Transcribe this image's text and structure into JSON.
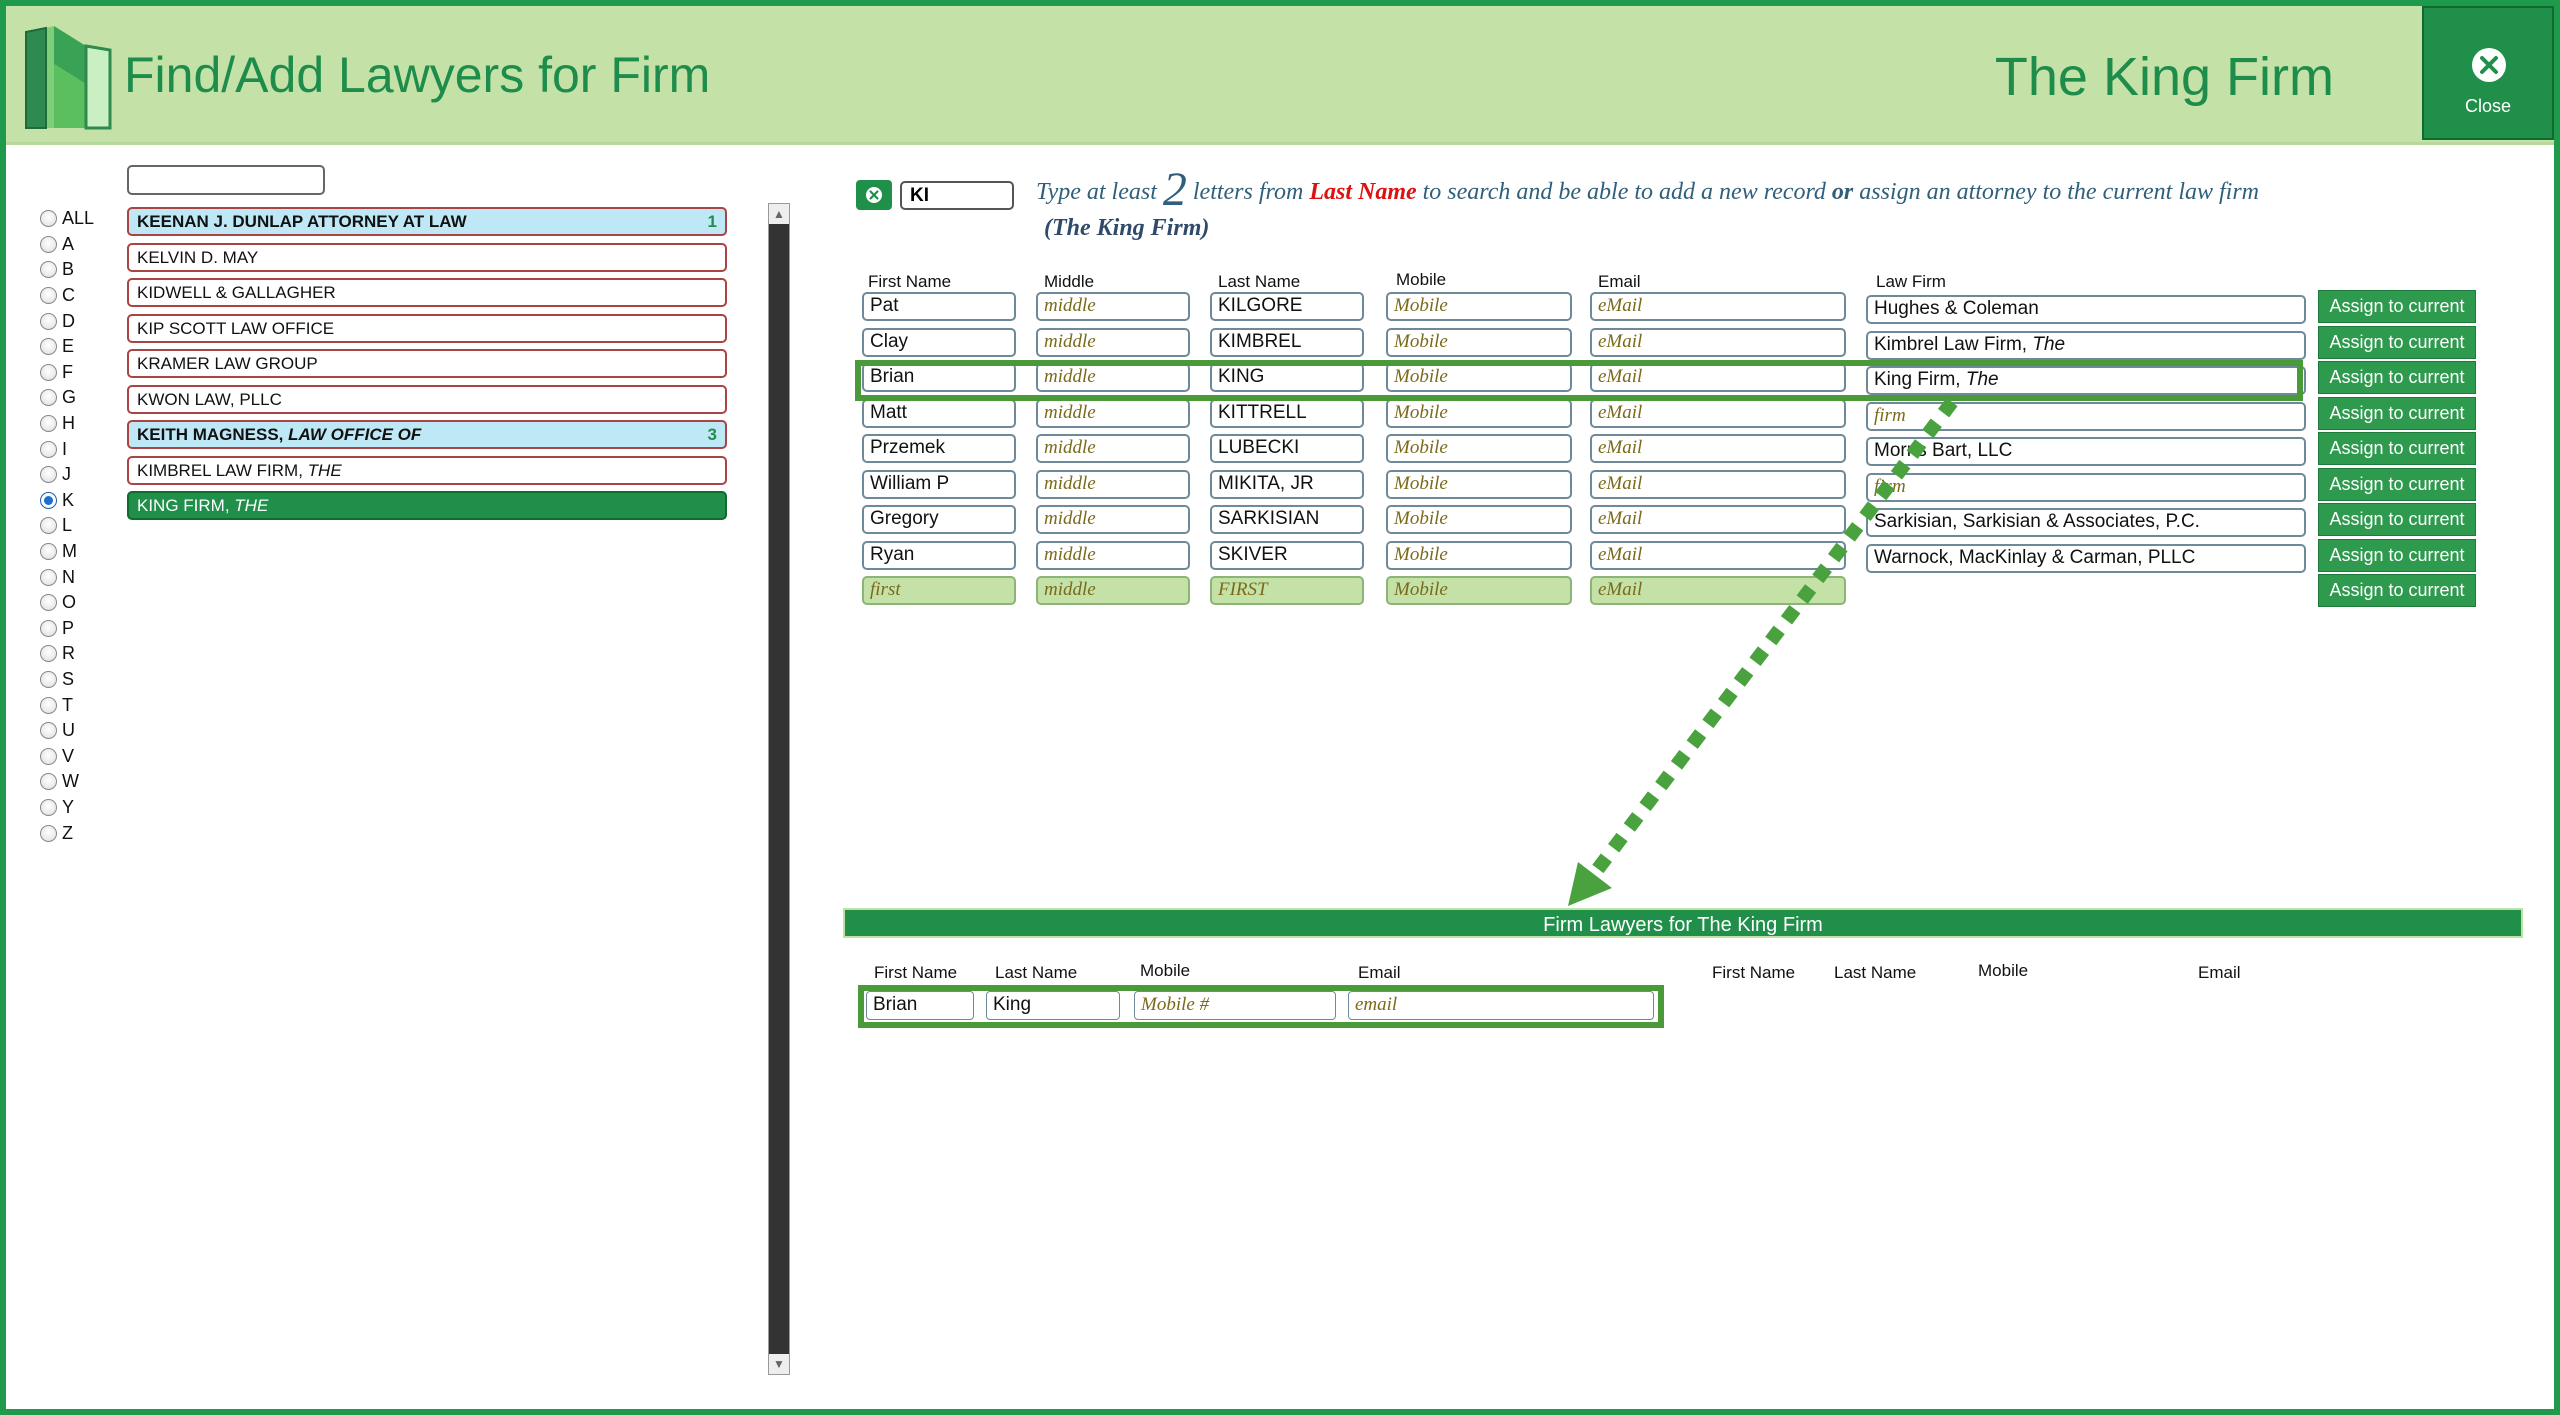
{
  "header": {
    "title": "Find/Add Lawyers for Firm",
    "firm_title": "The King Firm",
    "close_label": "Close"
  },
  "alphabet": [
    "ALL",
    "A",
    "B",
    "C",
    "D",
    "E",
    "F",
    "G",
    "H",
    "I",
    "J",
    "K",
    "L",
    "M",
    "N",
    "O",
    "P",
    "R",
    "S",
    "T",
    "U",
    "V",
    "W",
    "Y",
    "Z"
  ],
  "alphabet_selected": "K",
  "firms": [
    {
      "name": "KEENAN J. DUNLAP ATTORNEY AT LAW",
      "italic": "",
      "count": "1",
      "kind": "group"
    },
    {
      "name": "KELVIN D. MAY",
      "italic": "",
      "count": "",
      "kind": "normal"
    },
    {
      "name": "KIDWELL & GALLAGHER",
      "italic": "",
      "count": "",
      "kind": "normal"
    },
    {
      "name": "KIP SCOTT LAW OFFICE",
      "italic": "",
      "count": "",
      "kind": "normal"
    },
    {
      "name": "KRAMER LAW GROUP",
      "italic": "",
      "count": "",
      "kind": "normal"
    },
    {
      "name": "KWON LAW, PLLC",
      "italic": "",
      "count": "",
      "kind": "normal"
    },
    {
      "name": "KEITH MAGNESS, ",
      "italic": "LAW OFFICE OF",
      "count": "3",
      "kind": "group"
    },
    {
      "name": "KIMBREL LAW FIRM, ",
      "italic": "THE",
      "count": "",
      "kind": "normal"
    },
    {
      "name": "KING FIRM, ",
      "italic": "THE",
      "count": "",
      "kind": "selected"
    }
  ],
  "search": {
    "value": "KI",
    "hint_pre": "Type at least ",
    "hint_num": "2",
    "hint_mid": " letters from ",
    "hint_field": "Last Name",
    "hint_post1": " to search and be able to add a new record ",
    "hint_or": "or",
    "hint_post2": " assign an attorney to the current law firm",
    "hint_firm": "(The King Firm)"
  },
  "columns": {
    "first": "First Name",
    "middle": "Middle",
    "last": "Last Name",
    "mobile": "Mobile",
    "email": "Email",
    "firm": "Law Firm"
  },
  "placeholders": {
    "middle": "middle",
    "mobile": "Mobile",
    "email": "eMail",
    "firm": "firm",
    "first": "first",
    "last_new": "FIRST"
  },
  "assign_label": "Assign to current",
  "lawyers": [
    {
      "first": "Pat",
      "last": "KILGORE",
      "firm": "Hughes & Coleman",
      "firm_italic": ""
    },
    {
      "first": "Clay",
      "last": "KIMBREL",
      "firm": "Kimbrel Law Firm, ",
      "firm_italic": "The"
    },
    {
      "first": "Brian",
      "last": "KING",
      "firm": "King Firm, ",
      "firm_italic": "The"
    },
    {
      "first": "Matt",
      "last": "KITTRELL",
      "firm": "",
      "firm_italic": ""
    },
    {
      "first": "Przemek",
      "last": "LUBECKI",
      "firm": "Morris Bart, LLC",
      "firm_italic": ""
    },
    {
      "first": "William P",
      "last": "MIKITA, JR",
      "firm": "",
      "firm_italic": ""
    },
    {
      "first": "Gregory",
      "last": "SARKISIAN",
      "firm": "Sarkisian, Sarkisian & Associates, P.C.",
      "firm_italic": ""
    },
    {
      "first": "Ryan",
      "last": "SKIVER",
      "firm": "Warnock, MacKinlay & Carman, PLLC",
      "firm_italic": ""
    }
  ],
  "firm_lawyers": {
    "bar_title": "Firm Lawyers for The King Firm",
    "columns": {
      "first": "First Name",
      "last": "Last Name",
      "mobile": "Mobile",
      "email": "Email"
    },
    "rows": [
      {
        "first": "Brian",
        "last": "King",
        "mobile_ph": "Mobile #",
        "email_ph": "email"
      }
    ]
  },
  "colors": {
    "brand_green": "#1f8f4a",
    "header_bg": "#c4e2a8",
    "group_bg": "#bfe8f7",
    "hint_red": "#dd1111"
  }
}
